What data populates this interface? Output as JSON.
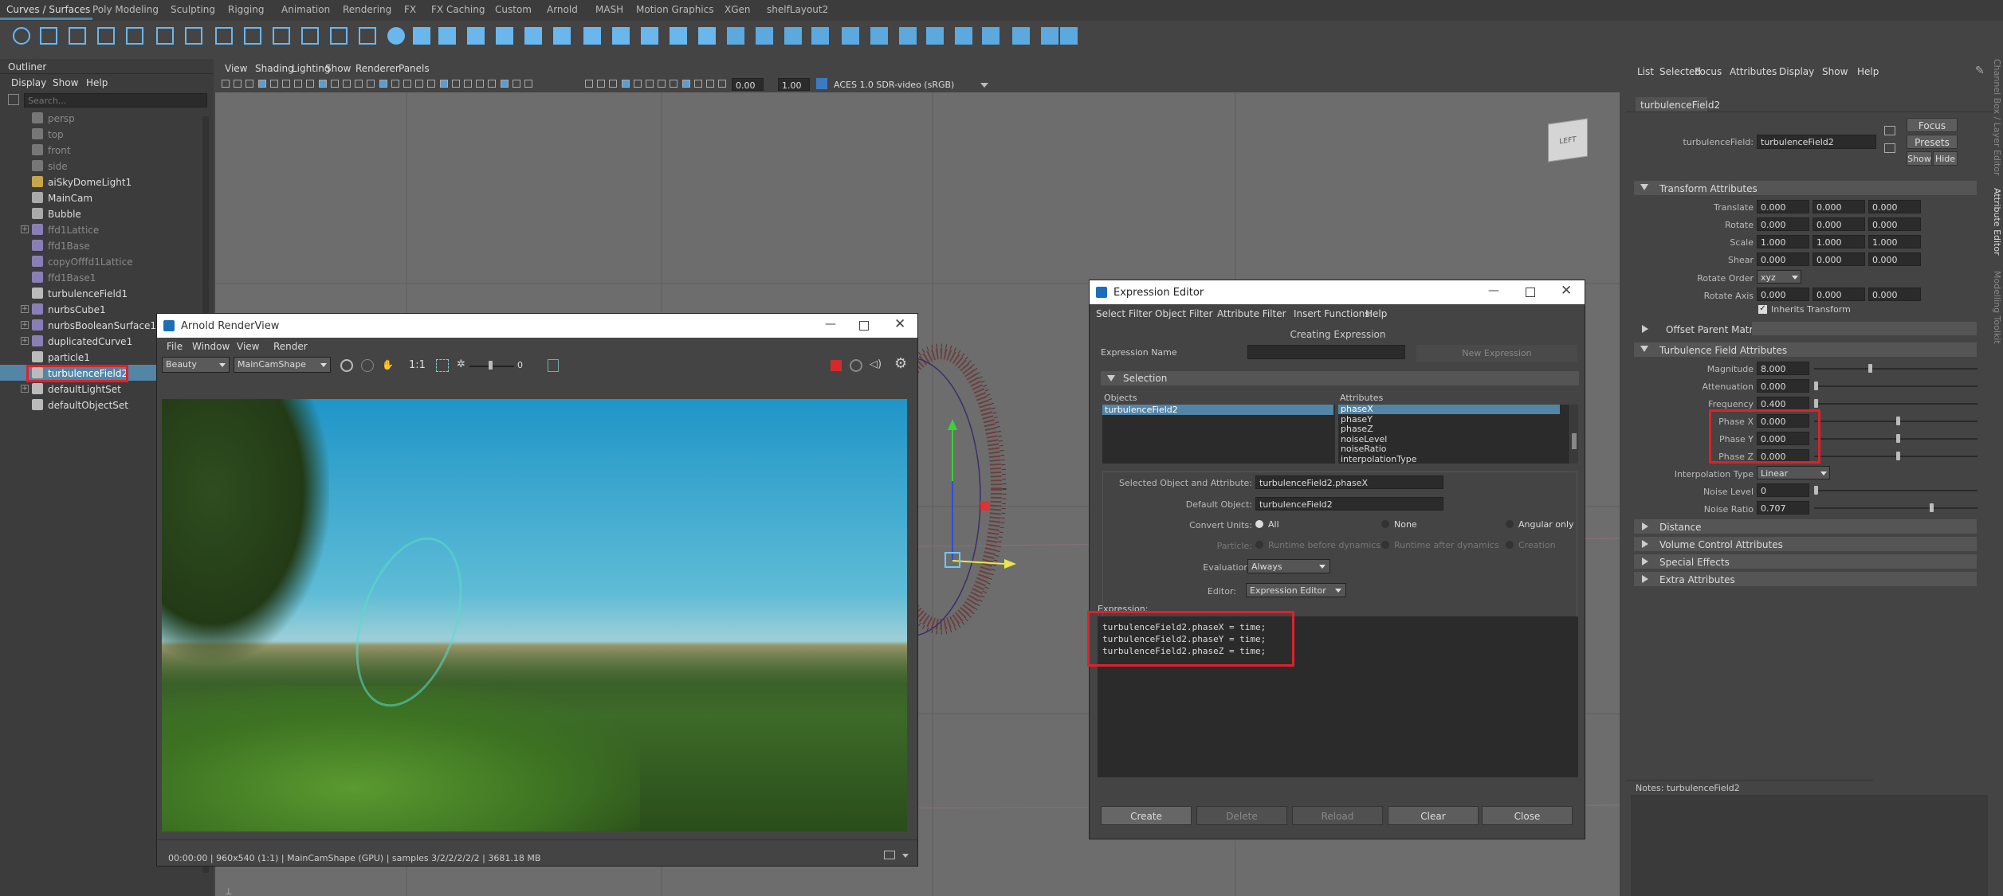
{
  "shelf": {
    "tabs": [
      "Curves / Surfaces",
      "Poly Modeling",
      "Sculpting",
      "Rigging",
      "Animation",
      "Rendering",
      "FX",
      "FX Caching",
      "Custom",
      "Arnold",
      "MASH",
      "Motion Graphics",
      "XGen",
      "shelfLayout2"
    ]
  },
  "outliner": {
    "title": "Outliner",
    "menu": [
      "Display",
      "Show",
      "Help"
    ],
    "search_placeholder": "Search...",
    "items": [
      {
        "label": "persp",
        "dim": true
      },
      {
        "label": "top",
        "dim": true
      },
      {
        "label": "front",
        "dim": true
      },
      {
        "label": "side",
        "dim": true
      },
      {
        "label": "aiSkyDomeLight1"
      },
      {
        "label": "MainCam"
      },
      {
        "label": "Bubble"
      },
      {
        "label": "ffd1Lattice",
        "dim": true
      },
      {
        "label": "ffd1Base",
        "dim": true
      },
      {
        "label": "copyOfffd1Lattice",
        "dim": true
      },
      {
        "label": "ffd1Base1",
        "dim": true
      },
      {
        "label": "turbulenceField1"
      },
      {
        "label": "nurbsCube1"
      },
      {
        "label": "nurbsBooleanSurface1"
      },
      {
        "label": "duplicatedCurve1"
      },
      {
        "label": "particle1"
      },
      {
        "label": "turbulenceField2",
        "selected": true
      },
      {
        "label": "defaultLightSet"
      },
      {
        "label": "defaultObjectSet"
      }
    ]
  },
  "viewport": {
    "menu": [
      "View",
      "Shading",
      "Lighting",
      "Show",
      "Renderer",
      "Panels"
    ],
    "exposure": "0.00",
    "gamma": "1.00",
    "color_space": "ACES 1.0 SDR-video (sRGB)",
    "viewcube_label": "LEFT"
  },
  "render_view": {
    "title": "Arnold RenderView",
    "menu": [
      "File",
      "Window",
      "View",
      "Render"
    ],
    "aov": "Beauty",
    "camera": "MainCamShape",
    "ratio": "1:1",
    "exposure": "0",
    "status": "00:00:00 | 960x540 (1:1) | MainCamShape  (GPU) | samples 3/2/2/2/2/2 | 3681.18 MB"
  },
  "expr_editor": {
    "title": "Expression Editor",
    "menu": [
      "Select Filter",
      "Object Filter",
      "Attribute Filter",
      "Insert Functions",
      "Help"
    ],
    "mode": "Creating Expression",
    "name_label": "Expression Name",
    "new_expr": "New Expression",
    "selection": "Selection",
    "objects_label": "Objects",
    "attributes_label": "Attributes",
    "objects": [
      "turbulenceField2"
    ],
    "attributes": [
      "phaseX",
      "phaseY",
      "phaseZ",
      "noiseLevel",
      "noiseRatio",
      "interpolationType"
    ],
    "sel_obj_label": "Selected Object and Attribute:",
    "sel_obj": "turbulenceField2.phaseX",
    "def_obj_label": "Default Object:",
    "def_obj": "turbulenceField2",
    "convert_label": "Convert Units:",
    "convert_opts": [
      "All",
      "None",
      "Angular only"
    ],
    "particle_label": "Particle:",
    "particle_opts": [
      "Runtime before dynamics",
      "Runtime after dynamics",
      "Creation"
    ],
    "eval_label": "Evaluation:",
    "eval": "Always",
    "editor_label": "Editor:",
    "editor": "Expression Editor",
    "expression_label": "Expression:",
    "code": [
      "turbulenceField2.phaseX = time;",
      "turbulenceField2.phaseY = time;",
      "turbulenceField2.phaseZ = time;"
    ],
    "buttons": [
      "Create",
      "Delete",
      "Reload",
      "Clear",
      "Close"
    ]
  },
  "attr_editor": {
    "menu": [
      "List",
      "Selected",
      "Focus",
      "Attributes",
      "Display",
      "Show",
      "Help"
    ],
    "tab": "turbulenceField2",
    "node_label": "turbulenceField:",
    "node": "turbulenceField2",
    "focus": "Focus",
    "presets": "Presets",
    "show": "Show",
    "hide": "Hide",
    "transform": "Transform Attributes",
    "translate": [
      "0.000",
      "0.000",
      "0.000"
    ],
    "rotate": [
      "0.000",
      "0.000",
      "0.000"
    ],
    "scale": [
      "1.000",
      "1.000",
      "1.000"
    ],
    "shear": [
      "0.000",
      "0.000",
      "0.000"
    ],
    "rotate_order": "xyz",
    "rotate_axis": [
      "0.000",
      "0.000",
      "0.000"
    ],
    "inherits": "Inherits Transform",
    "offset": "Offset Parent Matrix",
    "tfa": "Turbulence Field Attributes",
    "magnitude": "8.000",
    "attenuation": "0.000",
    "frequency": "0.400",
    "phase_x": "0.000",
    "phase_y": "0.000",
    "phase_z": "0.000",
    "interp": "Linear",
    "noise_level": "0",
    "noise_ratio": "0.707",
    "collapsed": [
      "Distance",
      "Volume Control Attributes",
      "Special Effects",
      "Extra Attributes"
    ],
    "notes": "Notes:  turbulenceField2",
    "side_tabs": [
      "Channel Box / Layer Editor",
      "Attribute Editor",
      "Modelling Toolkit"
    ]
  }
}
